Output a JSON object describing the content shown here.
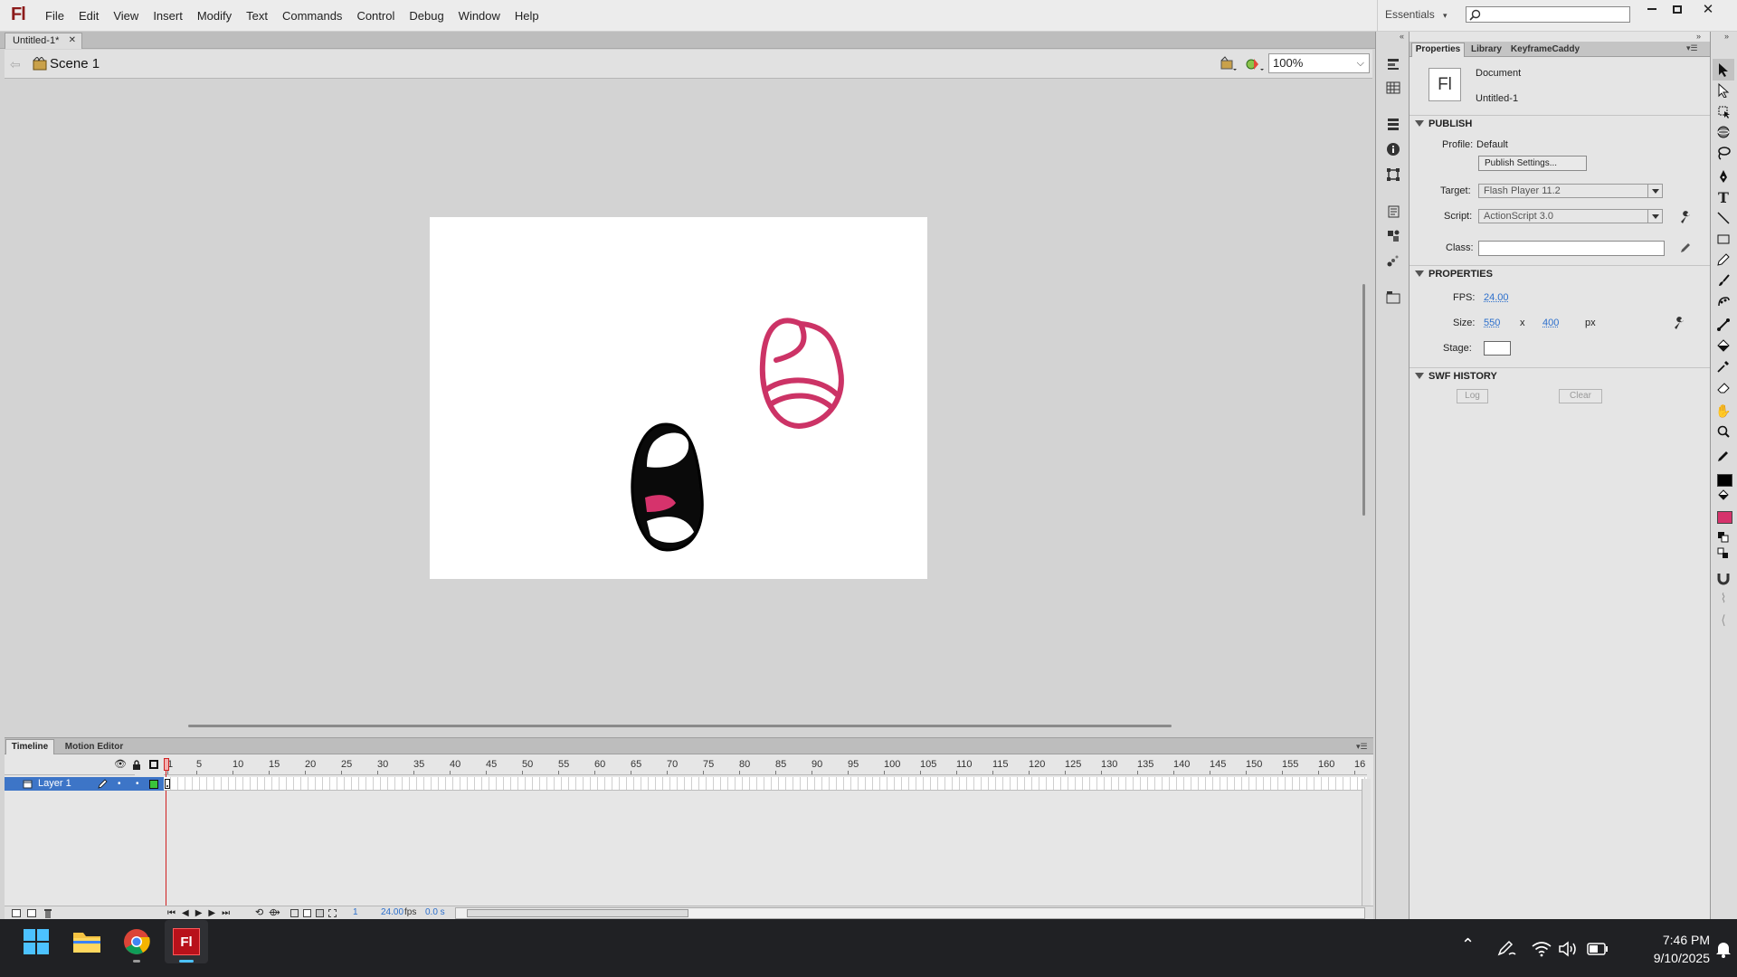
{
  "app": {
    "logo": "Fl"
  },
  "menu": [
    "File",
    "Edit",
    "View",
    "Insert",
    "Modify",
    "Text",
    "Commands",
    "Control",
    "Debug",
    "Window",
    "Help"
  ],
  "workspace": {
    "label": "Essentials",
    "search_placeholder": ""
  },
  "doc_tab": {
    "label": "Untitled-1*"
  },
  "scene": {
    "label": "Scene 1",
    "zoom": "100%"
  },
  "properties_panel": {
    "tabs": [
      "Properties",
      "Library",
      "KeyframeCaddy"
    ],
    "doc_type": "Document",
    "doc_name": "Untitled-1",
    "publish": {
      "title": "PUBLISH",
      "profile_label": "Profile:",
      "profile_value": "Default",
      "publish_settings_button": "Publish Settings...",
      "target_label": "Target:",
      "target_value": "Flash Player 11.2",
      "script_label": "Script:",
      "script_value": "ActionScript 3.0",
      "class_label": "Class:",
      "class_value": ""
    },
    "properties": {
      "title": "PROPERTIES",
      "fps_label": "FPS:",
      "fps_value": "24.00",
      "size_label": "Size:",
      "width": "550",
      "x": "x",
      "height": "400",
      "unit": "px",
      "stage_label": "Stage:",
      "stage_color": "#ffffff"
    },
    "swf_history": {
      "title": "SWF HISTORY",
      "log_button": "Log",
      "clear_button": "Clear"
    }
  },
  "timeline": {
    "tabs": [
      "Timeline",
      "Motion Editor"
    ],
    "layer_name": "Layer 1",
    "ruler": [
      "1",
      "5",
      "10",
      "15",
      "20",
      "25",
      "30",
      "35",
      "40",
      "45",
      "50",
      "55",
      "60",
      "65",
      "70",
      "75",
      "80",
      "85",
      "90",
      "95",
      "100",
      "105",
      "110",
      "115",
      "120",
      "125",
      "130",
      "135",
      "140",
      "145",
      "150",
      "155",
      "160",
      "16"
    ],
    "current_frame": "1",
    "fps": "24.00",
    "fps_unit": "fps",
    "elapsed": "0.0 s"
  },
  "colors": {
    "stroke": "#000000",
    "fill": "#d6336c",
    "accent": "#cc3366"
  },
  "taskbar": {
    "time": "7:46 PM",
    "date": "9/10/2025",
    "flash_label": "Fl"
  }
}
